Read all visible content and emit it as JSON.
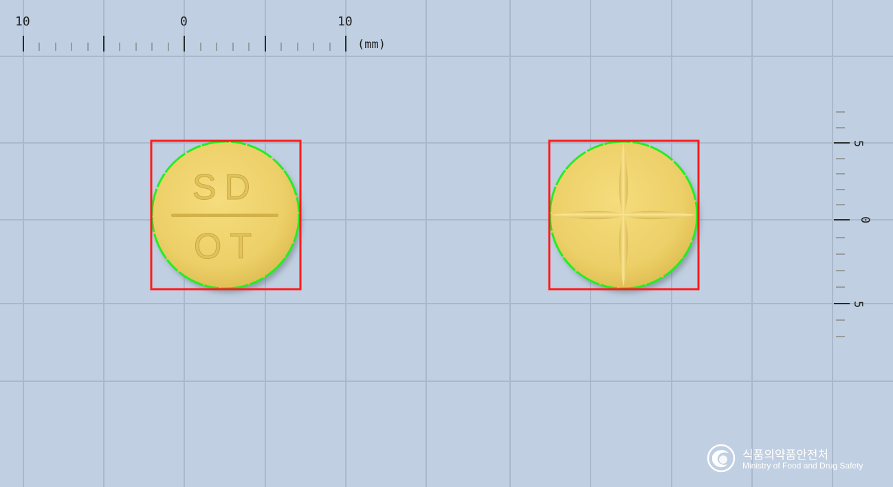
{
  "ruler_top": {
    "labels": [
      "10",
      "0",
      "10"
    ],
    "unit": "(mm)"
  },
  "ruler_right": {
    "labels": [
      "5",
      "0",
      "5"
    ]
  },
  "tablets": [
    {
      "side": "front",
      "imprint_top": "SD",
      "imprint_bottom": "OT",
      "color": "#f1d36f"
    },
    {
      "side": "back",
      "score": "cross",
      "color": "#f1d36f"
    }
  ],
  "colors": {
    "background": "#c0cfe1",
    "grid": "#a9b8cb",
    "bounding_box": "#ff1a1a",
    "contour": "#22ee22",
    "tablet": "#f1d36f"
  },
  "watermark": {
    "korean": "식품의약품안전처",
    "english": "Ministry of Food and Drug Safety"
  }
}
